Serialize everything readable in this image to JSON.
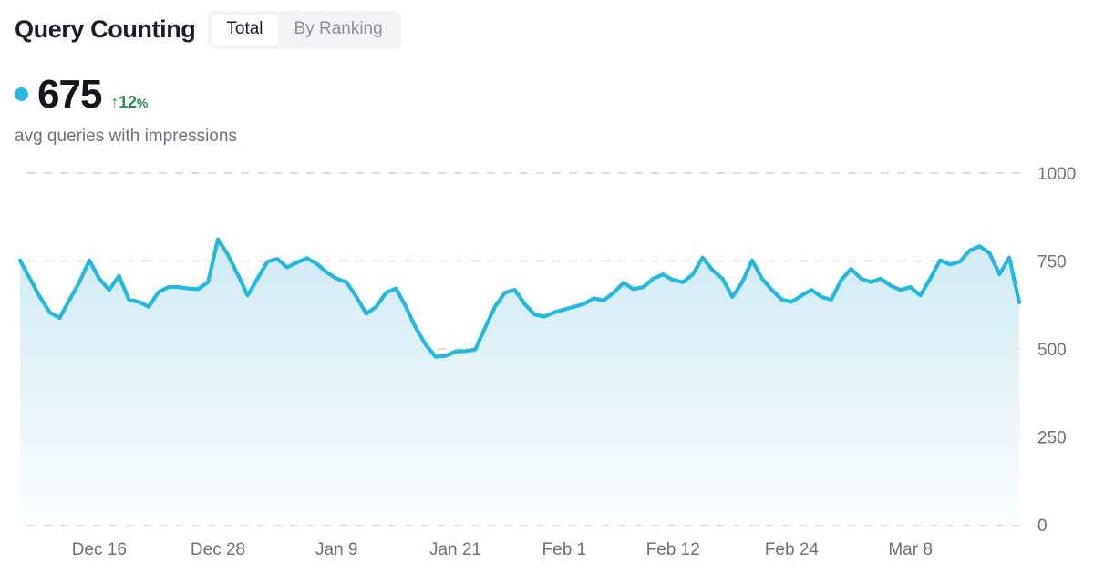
{
  "header": {
    "title": "Query Counting",
    "tabs": [
      {
        "label": "Total",
        "active": true
      },
      {
        "label": "By Ranking",
        "active": false
      }
    ]
  },
  "kpi": {
    "dot_color": "#22b8e0",
    "value": "675",
    "delta": "↑12",
    "delta_unit": "%",
    "delta_color": "#2f8c4f",
    "subtitle": "avg queries with impressions"
  },
  "chart_data": {
    "type": "area",
    "title": "Query Counting",
    "xlabel": "",
    "ylabel": "",
    "ylim": [
      0,
      1000
    ],
    "yticks": [
      0,
      250,
      500,
      750,
      1000
    ],
    "ytick_labels": [
      "0",
      "250",
      "500",
      "750",
      "1000"
    ],
    "grid": true,
    "legend": false,
    "line_color": "#22b8e0",
    "fill_top_color": "#cfeaf4",
    "fill_bottom_color": "#fbfeff",
    "grid_color": "#cfd1d6",
    "x_tick_labels": [
      "Dec 16",
      "Dec 28",
      "Jan 9",
      "Jan 21",
      "Feb 1",
      "Feb 12",
      "Feb 24",
      "Mar 8"
    ],
    "x_tick_indices": [
      8,
      20,
      32,
      44,
      55,
      66,
      78,
      90
    ],
    "series": [
      {
        "name": "avg queries with impressions",
        "values": [
          752,
          700,
          648,
          604,
          588,
          640,
          690,
          752,
          700,
          668,
          708,
          640,
          634,
          620,
          662,
          676,
          676,
          672,
          670,
          690,
          812,
          768,
          712,
          652,
          700,
          748,
          756,
          732,
          746,
          758,
          742,
          718,
          700,
          690,
          648,
          600,
          620,
          660,
          672,
          620,
          560,
          512,
          478,
          480,
          492,
          494,
          498,
          560,
          620,
          660,
          668,
          628,
          598,
          592,
          604,
          612,
          620,
          628,
          644,
          638,
          660,
          688,
          670,
          676,
          700,
          712,
          696,
          690,
          712,
          760,
          724,
          700,
          648,
          690,
          752,
          700,
          668,
          640,
          634,
          652,
          668,
          648,
          640,
          696,
          728,
          700,
          690,
          700,
          680,
          668,
          676,
          652,
          700,
          752,
          740,
          748,
          780,
          792,
          772,
          712,
          760,
          632
        ]
      }
    ]
  }
}
